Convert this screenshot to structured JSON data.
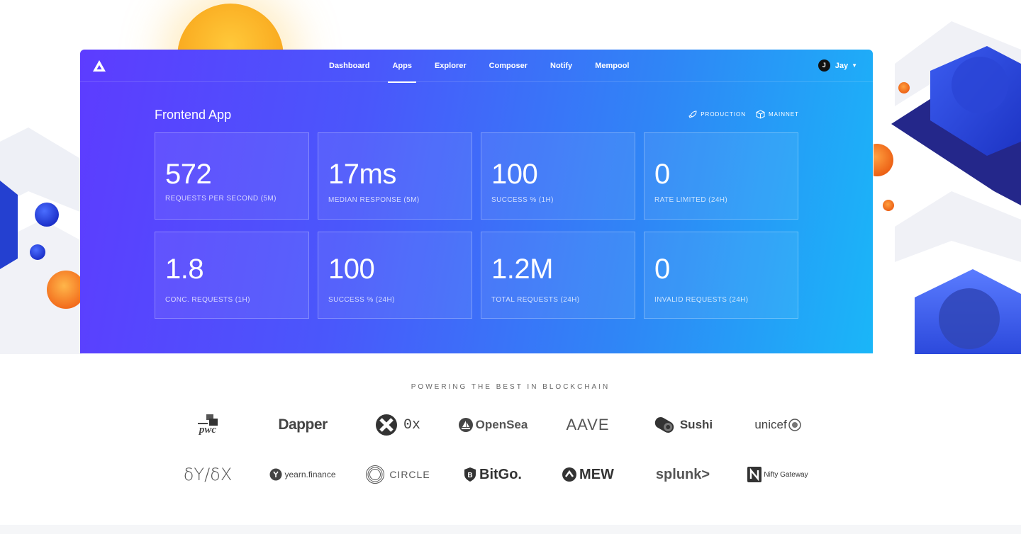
{
  "nav": {
    "items": [
      {
        "label": "Dashboard",
        "active": false
      },
      {
        "label": "Apps",
        "active": true
      },
      {
        "label": "Explorer",
        "active": false
      },
      {
        "label": "Composer",
        "active": false
      },
      {
        "label": "Notify",
        "active": false
      },
      {
        "label": "Mempool",
        "active": false
      }
    ]
  },
  "user": {
    "initial": "J",
    "name": "Jay"
  },
  "app": {
    "title": "Frontend App",
    "environment": "PRODUCTION",
    "network": "MAINNET"
  },
  "stats": [
    {
      "value": "572",
      "label": "REQUESTS PER SECOND (5M)"
    },
    {
      "value": "17ms",
      "label": "MEDIAN RESPONSE (5M)"
    },
    {
      "value": "100",
      "label": "SUCCESS % (1H)"
    },
    {
      "value": "0",
      "label": "RATE LIMITED (24H)"
    },
    {
      "value": "1.8",
      "label": "CONC. REQUESTS (1H)"
    },
    {
      "value": "100",
      "label": "SUCCESS % (24H)"
    },
    {
      "value": "1.2M",
      "label": "TOTAL REQUESTS (24H)"
    },
    {
      "value": "0",
      "label": "INVALID REQUESTS (24H)"
    }
  ],
  "partners": {
    "tagline": "POWERING THE BEST IN BLOCKCHAIN",
    "row1": [
      "pwc",
      "Dapper",
      "0x",
      "OpenSea",
      "AAVE",
      "Sushi",
      "unicef"
    ],
    "row2": [
      "δY/δX",
      "yearn.finance",
      "CIRCLE",
      "BitGo.",
      "MEW",
      "splunk>",
      "Nifty Gateway"
    ]
  },
  "colors": {
    "gradient_start": "#5d3cff",
    "gradient_end": "#1ab6f8",
    "sun": "#f9a81e",
    "orange_ball": "#f26a1b"
  }
}
